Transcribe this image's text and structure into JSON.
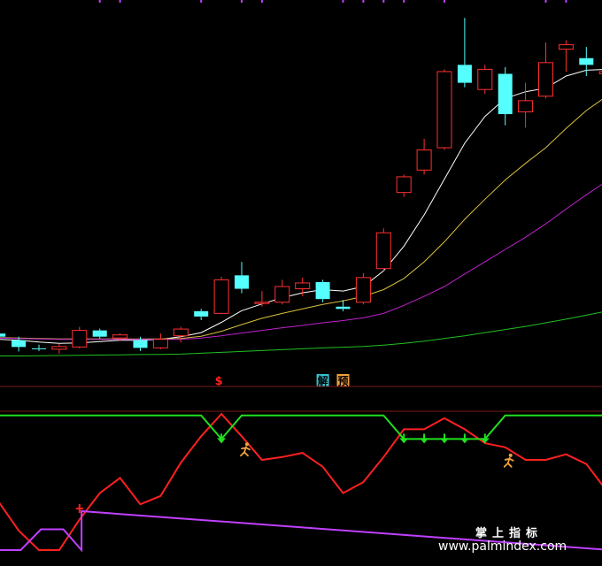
{
  "watermark": {
    "cn": "掌上指标",
    "url": "www.palmindex.com"
  },
  "badges": [
    {
      "text": "$",
      "kind": "dollar",
      "color": "#ff2020",
      "bar": 11
    },
    {
      "text": "解",
      "kind": "box",
      "color": "#39c0d0",
      "bar": 16
    },
    {
      "text": "预",
      "kind": "box",
      "color": "#f0a040",
      "bar": 17
    }
  ],
  "chart_data": [
    {
      "type": "candlestick",
      "title": "",
      "colors": {
        "up": "#ff3030",
        "down": "#55ffff",
        "ma1": "#ffffff",
        "ma2": "#d8c040",
        "ma3": "#c020d0",
        "ma4": "#20c020"
      },
      "ylim": [
        29,
        108
      ],
      "candles": [
        {
          "o": 34.5,
          "h": 35.0,
          "l": 33.5,
          "c": 33.8
        },
        {
          "o": 33.0,
          "h": 33.8,
          "l": 30.5,
          "c": 31.5
        },
        {
          "o": 31.2,
          "h": 32.0,
          "l": 30.6,
          "c": 31.0
        },
        {
          "o": 31.0,
          "h": 32.2,
          "l": 30.0,
          "c": 31.6
        },
        {
          "o": 31.5,
          "h": 36.0,
          "l": 31.2,
          "c": 35.2
        },
        {
          "o": 35.2,
          "h": 35.6,
          "l": 33.4,
          "c": 33.8
        },
        {
          "o": 33.5,
          "h": 34.5,
          "l": 32.8,
          "c": 34.2
        },
        {
          "o": 33.0,
          "h": 33.8,
          "l": 30.6,
          "c": 31.3
        },
        {
          "o": 31.3,
          "h": 34.5,
          "l": 31.0,
          "c": 33.2
        },
        {
          "o": 34.0,
          "h": 36.0,
          "l": 32.5,
          "c": 35.5
        },
        {
          "o": 39.5,
          "h": 40.0,
          "l": 37.5,
          "c": 38.3
        },
        {
          "o": 39.0,
          "h": 47.2,
          "l": 38.8,
          "c": 46.5
        },
        {
          "o": 47.5,
          "h": 50.5,
          "l": 43.5,
          "c": 44.5
        },
        {
          "o": 41.2,
          "h": 44.0,
          "l": 40.5,
          "c": 41.5
        },
        {
          "o": 41.5,
          "h": 46.5,
          "l": 41.0,
          "c": 45.0
        },
        {
          "o": 44.5,
          "h": 47.0,
          "l": 42.8,
          "c": 45.8
        },
        {
          "o": 46.0,
          "h": 46.5,
          "l": 41.5,
          "c": 42.2
        },
        {
          "o": 40.5,
          "h": 42.0,
          "l": 39.5,
          "c": 40.0
        },
        {
          "o": 41.5,
          "h": 48.0,
          "l": 41.0,
          "c": 47.0
        },
        {
          "o": 49.0,
          "h": 58.0,
          "l": 48.5,
          "c": 57.0
        },
        {
          "o": 66.0,
          "h": 70.0,
          "l": 65.0,
          "c": 69.5
        },
        {
          "o": 71.0,
          "h": 78.0,
          "l": 70.0,
          "c": 75.5
        },
        {
          "o": 76.0,
          "h": 93.5,
          "l": 75.5,
          "c": 93.0
        },
        {
          "o": 94.5,
          "h": 105.0,
          "l": 89.5,
          "c": 90.5
        },
        {
          "o": 89.0,
          "h": 94.5,
          "l": 88.0,
          "c": 93.5
        },
        {
          "o": 92.5,
          "h": 94.0,
          "l": 81.0,
          "c": 83.5
        },
        {
          "o": 84.0,
          "h": 90.5,
          "l": 80.5,
          "c": 86.5
        },
        {
          "o": 87.5,
          "h": 99.5,
          "l": 87.0,
          "c": 95.0
        },
        {
          "o": 98.0,
          "h": 100.0,
          "l": 93.0,
          "c": 99.0
        },
        {
          "o": 96.0,
          "h": 98.5,
          "l": 92.0,
          "c": 94.5
        },
        {
          "o": 92.5,
          "h": 93.5,
          "l": 86.5,
          "c": 93.0
        }
      ],
      "ma": [
        {
          "name": "MA1",
          "values": [
            33.2,
            33.0,
            32.6,
            32.3,
            32.4,
            32.7,
            33.0,
            33.0,
            33.2,
            33.8,
            34.7,
            37.0,
            39.6,
            41.1,
            42.5,
            43.6,
            44.3,
            44.0,
            45.0,
            48.5,
            54.0,
            61.0,
            69.0,
            77.0,
            83.0,
            87.0,
            88.5,
            89.3,
            92.0,
            93.3,
            93.5
          ]
        },
        {
          "name": "MA2",
          "values": [
            33.6,
            33.5,
            33.4,
            33.3,
            33.3,
            33.3,
            33.3,
            33.3,
            33.3,
            33.4,
            33.9,
            35.0,
            36.5,
            37.9,
            39.0,
            40.0,
            41.0,
            41.8,
            42.8,
            44.3,
            46.8,
            50.5,
            55.0,
            60.0,
            64.5,
            68.8,
            72.5,
            76.0,
            80.3,
            84.3,
            87.5
          ]
        },
        {
          "name": "MA3",
          "values": [
            33.5,
            33.4,
            33.3,
            33.2,
            33.2,
            33.2,
            33.2,
            33.2,
            33.2,
            33.2,
            33.5,
            34.0,
            34.6,
            35.2,
            35.8,
            36.3,
            36.9,
            37.4,
            38.0,
            39.0,
            40.8,
            42.8,
            45.0,
            47.8,
            50.5,
            53.3,
            56.0,
            59.0,
            62.3,
            65.5,
            68.5
          ]
        },
        {
          "name": "MA4",
          "values": [
            29.5,
            29.5,
            29.55,
            29.6,
            29.65,
            29.7,
            29.75,
            29.8,
            29.85,
            29.9,
            30.1,
            30.3,
            30.5,
            30.7,
            30.9,
            31.1,
            31.3,
            31.45,
            31.6,
            31.9,
            32.3,
            32.8,
            33.4,
            34.0,
            34.7,
            35.4,
            36.1,
            36.9,
            37.7,
            38.6,
            39.5
          ]
        }
      ]
    },
    {
      "type": "line",
      "title": "",
      "ylim": [
        0,
        100
      ],
      "series": [
        {
          "key": "red",
          "color": "#ff2020",
          "x": [
            0,
            1,
            2,
            3,
            4,
            5,
            6,
            7,
            8,
            9,
            10,
            11,
            12,
            13,
            14,
            15,
            16,
            17,
            18,
            19,
            20,
            21,
            22,
            23,
            24,
            25,
            26,
            27,
            28,
            29,
            30.2
          ],
          "values": [
            35,
            14,
            0,
            0,
            22,
            41,
            52,
            33,
            39,
            63,
            82,
            98,
            82,
            65,
            67,
            70,
            60,
            41,
            49,
            67,
            87,
            87,
            95,
            87,
            77,
            74,
            65,
            65,
            69,
            62,
            39
          ]
        },
        {
          "key": "green",
          "color": "#20e020",
          "x": [
            -0.2,
            10,
            11,
            12,
            19,
            20,
            24,
            25,
            30.2
          ],
          "values": [
            97,
            97,
            80,
            97,
            97,
            80,
            80,
            97,
            97
          ]
        },
        {
          "key": "purple",
          "color": "#c040ff",
          "x": [
            -0.2,
            1.1,
            2.1,
            3.2,
            4.1,
            4.1,
            30.2
          ],
          "values": [
            0,
            0,
            15,
            15,
            0,
            28,
            0
          ]
        }
      ],
      "markers": [
        {
          "type": "down-arrow",
          "color": "#20e020",
          "x": [
            11,
            20,
            21,
            22,
            23,
            24
          ]
        },
        {
          "type": "runner",
          "color": "#f0a040",
          "x": [
            12,
            25
          ]
        },
        {
          "type": "plus",
          "color": "#ff2020",
          "x": [
            4
          ]
        }
      ],
      "reference_lines": [
        {
          "color": "#7a1a1a",
          "level": 100
        }
      ]
    }
  ]
}
